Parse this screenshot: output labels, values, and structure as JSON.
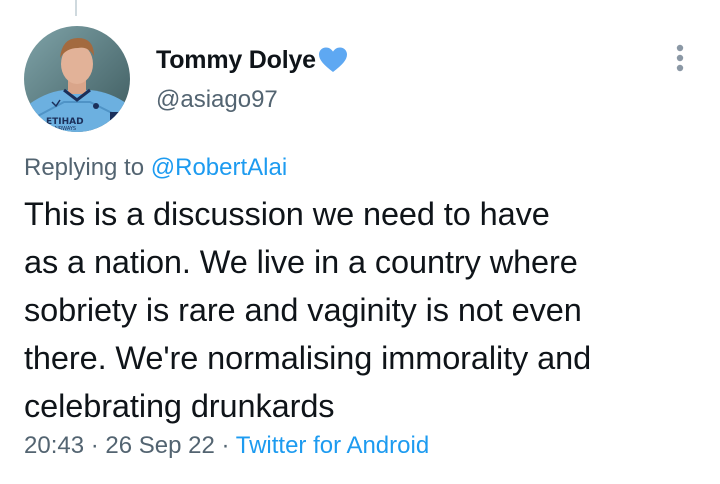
{
  "user": {
    "display_name": "Tommy Dolye",
    "handle": "@asiago97",
    "name_emoji": "blue-heart-icon",
    "avatar_text": "ETIHAD AIRWAYS"
  },
  "reply": {
    "prefix": "Replying to",
    "mention": "@RobertAlai"
  },
  "tweet": {
    "lines": [
      "This is a discussion we need to have",
      "as a nation. We live in a country where",
      "sobriety is rare and vaginity is not even",
      "there. We're normalising immorality and",
      "celebrating drunkards"
    ]
  },
  "meta": {
    "time": "20:43",
    "separator": "·",
    "date": "26 Sep 22",
    "source": "Twitter for Android"
  },
  "colors": {
    "text_primary": "#0f1419",
    "text_secondary": "#536471",
    "accent": "#1d9bf0",
    "heart": "#5ea8f2"
  },
  "icons": {
    "more": "more-vertical-icon"
  }
}
